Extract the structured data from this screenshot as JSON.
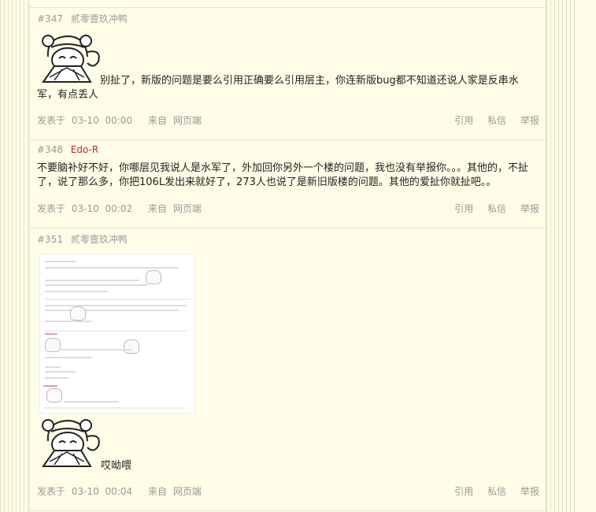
{
  "posts": [
    {
      "floor": "#347",
      "author": "贰零壹玖冲鸭",
      "content": "别扯了，新版的问题是要么引用正确要么引用层主，你连新版bug都不知道还说人家是反串水军，有点丢人",
      "posted_label": "发表于",
      "date": "03-10",
      "time": "00:00",
      "from_label": "来自",
      "source": "网页端"
    },
    {
      "floor": "#348",
      "author": "Edo-R",
      "content": "不要脑补好不好，你哪层见我说人是水军了，外加回你另外一个楼的问题，我也没有举报你。。。其他的，不扯了，说了那么多，你把106L发出来就好了，273人也说了是新旧版楼的问题。其他的爱扯你就扯吧。。",
      "posted_label": "发表于",
      "date": "03-10",
      "time": "00:02",
      "from_label": "来自",
      "source": "网页端"
    },
    {
      "floor": "#351",
      "author": "贰零壹玖冲鸭",
      "content": "哎呦喂",
      "posted_label": "发表于",
      "date": "03-10",
      "time": "00:04",
      "from_label": "来自",
      "source": "网页端"
    }
  ],
  "actions": {
    "quote": "引用",
    "message": "私信",
    "report": "举报"
  },
  "colors": {
    "background": "#fefde8",
    "author_highlight": "#c2283a",
    "meta": "#999999"
  }
}
